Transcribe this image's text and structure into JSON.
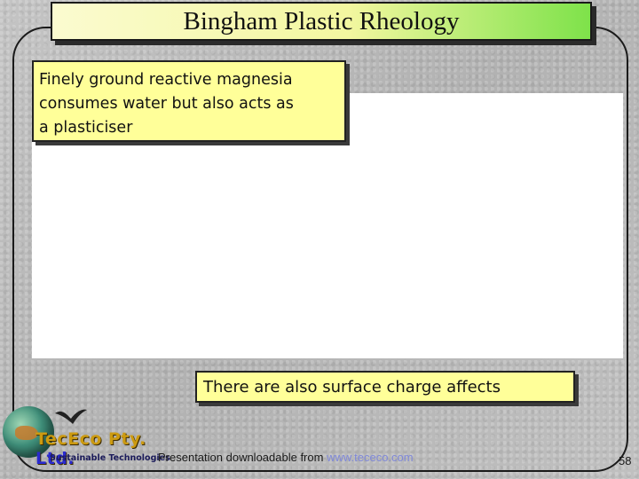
{
  "slide": {
    "title": "Bingham Plastic Rheology",
    "callout_top": {
      "lines": [
        "Finely ground reactive magnesia",
        "consumes water but also acts as",
        "a plasticiser"
      ]
    },
    "callout_bottom": "There are also surface charge affects",
    "page_number": "58"
  },
  "logo": {
    "name_main": "TecEco Pty.",
    "name_suffix": " Ltd.",
    "tagline": "Sustainable Technologies"
  },
  "footer": {
    "text": "Presentation downloadable from ",
    "link": "www.tececo.com"
  },
  "colors": {
    "title_gradient_start": "#fbfbd0",
    "title_gradient_end": "#7ee24a",
    "callout_fill": "#ffff99",
    "link": "#7f88d8"
  }
}
